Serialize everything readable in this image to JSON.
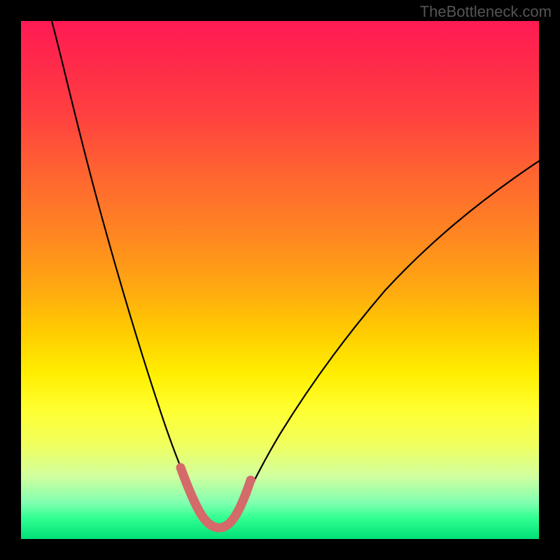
{
  "watermark": "TheBottleneck.com",
  "chart_data": {
    "type": "line",
    "title": "",
    "xlabel": "",
    "ylabel": "",
    "xlim": [
      0,
      100
    ],
    "ylim": [
      0,
      100
    ],
    "description": "V-shaped bottleneck curve over a vertical red-to-green gradient background. The curve descends steeply from the top-left, reaches a minimum near x≈37, and rises more gradually toward the right edge.",
    "series": [
      {
        "name": "main-curve",
        "color": "#000000",
        "x": [
          6,
          10,
          14,
          18,
          22,
          26,
          30,
          33,
          35,
          37,
          39,
          41,
          43,
          47,
          52,
          58,
          66,
          74,
          82,
          90,
          98
        ],
        "y": [
          100,
          85,
          70,
          56,
          43,
          31,
          20,
          12,
          6,
          3,
          3,
          5,
          8,
          14,
          21,
          29,
          38,
          46,
          53,
          60,
          66
        ]
      },
      {
        "name": "highlight-segment",
        "color": "#d86b6b",
        "x": [
          30,
          32,
          34,
          36,
          37,
          38,
          40,
          42,
          43
        ],
        "y": [
          14,
          9,
          5,
          3,
          3,
          3,
          4,
          6,
          9
        ]
      }
    ],
    "gradient_stops": [
      {
        "pct": 0,
        "color": "#ff1a54"
      },
      {
        "pct": 50,
        "color": "#ffcc00"
      },
      {
        "pct": 80,
        "color": "#ffff40"
      },
      {
        "pct": 100,
        "color": "#00e078"
      }
    ]
  }
}
